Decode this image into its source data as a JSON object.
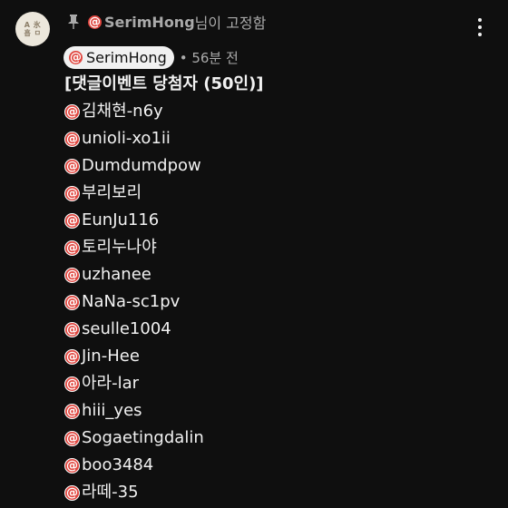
{
  "avatar": {
    "line1": "A 氷",
    "line2": "흡 ㅁ"
  },
  "pinned": {
    "name": "SerimHong",
    "suffix": "님이 고정함"
  },
  "author": {
    "name": "SerimHong",
    "time": "• 56분 전"
  },
  "comment": {
    "headline": "[댓글이벤트 당첨자 (50인)]",
    "mentions": [
      "김채현-n6y",
      "unioli-xo1ii",
      "Dumdumdpow",
      "부리보리",
      "EunJu116",
      "토리누나야",
      "uzhanee",
      "NaNa-sc1pv",
      "seulle1004",
      "Jin-Hee",
      "아라-lar",
      "hiii_yes",
      "Sogaetingdalin",
      "boo3484",
      "라떼-35"
    ]
  },
  "icons": {
    "pin": "pin-icon",
    "mention": "at-icon",
    "menu": "more-vert-icon"
  },
  "colors": {
    "background": "#0f0f0f",
    "text": "#f1f1f1",
    "secondary": "#aaaaaa",
    "mention_badge": "#e0463f",
    "chip": "#f1f1f1"
  }
}
